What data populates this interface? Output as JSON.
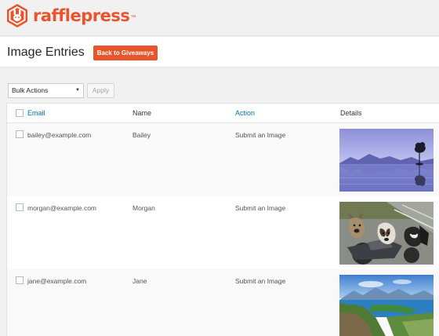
{
  "brand": {
    "name": "rafflepress",
    "tm": "™",
    "color": "#e8542c"
  },
  "header": {
    "title": "Image Entries",
    "back_label": "Back to Giveaways"
  },
  "toolbar": {
    "bulk_actions": "Bulk Actions",
    "apply_label": "Apply"
  },
  "table": {
    "columns": {
      "email": "Email",
      "name": "Name",
      "action": "Action",
      "details": "Details"
    },
    "rows": [
      {
        "email": "bailey@example.com",
        "name": "Bailey",
        "action": "Submit an Image",
        "image": "lake-reflection-photo"
      },
      {
        "email": "morgan@example.com",
        "name": "Morgan",
        "action": "Submit an Image",
        "image": "dogs-on-scooter-photo"
      },
      {
        "email": "jane@example.com",
        "name": "Jane",
        "action": "Submit an Image",
        "image": "mountain-lake-photo"
      }
    ]
  }
}
